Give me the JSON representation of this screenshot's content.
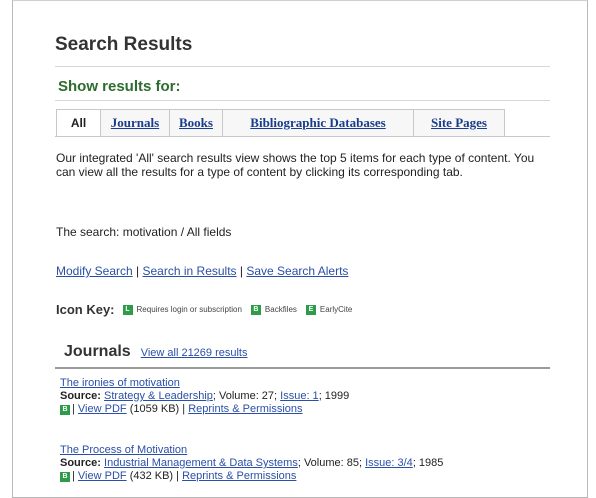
{
  "page": {
    "title": "Search Results",
    "show_results_for": "Show results for:"
  },
  "tabs": [
    {
      "label": "All",
      "active": true
    },
    {
      "label": "Journals",
      "active": false
    },
    {
      "label": "Books",
      "active": false
    },
    {
      "label": "Bibliographic Databases",
      "active": false
    },
    {
      "label": "Site Pages",
      "active": false
    }
  ],
  "description": "Our integrated 'All' search results view shows the top 5 items for each type of content. You can view all the results for a type of content by clicking its corresponding tab.",
  "search_summary": "The search: motivation / All fields",
  "actions": {
    "modify": "Modify Search",
    "search_in_results": "Search in Results",
    "save_alerts": "Save Search Alerts",
    "separator": " | "
  },
  "icon_key": {
    "label": "Icon Key:",
    "items": [
      {
        "icon": "login-required-icon",
        "glyph": "L",
        "text": "Requires login or subscription"
      },
      {
        "icon": "backfiles-icon",
        "glyph": "B",
        "text": "Backfiles"
      },
      {
        "icon": "earlycite-icon",
        "glyph": "E",
        "text": "EarlyCite"
      }
    ],
    "icon_color": "#2e9b4a"
  },
  "journals": {
    "heading": "Journals",
    "view_all": "View all 21269 results",
    "results": [
      {
        "title": "The ironies of motivation",
        "source_label": "Source:",
        "journal": "Strategy & Leadership",
        "volume_text": "; Volume: 27; ",
        "issue": "Issue: 1",
        "year": "; 1999",
        "pdf_icon_glyph": "B",
        "pdf_label": "View PDF",
        "pdf_size": "(1059 KB)",
        "permissions": "Reprints & Permissions"
      },
      {
        "title": "The Process of Motivation",
        "source_label": "Source:",
        "journal": "Industrial Management & Data Systems",
        "volume_text": "; Volume: 85; ",
        "issue": "Issue: 3/4",
        "year": "; 1985",
        "pdf_icon_glyph": "B",
        "pdf_label": "View PDF",
        "pdf_size": "(432 KB)",
        "permissions": "Reprints & Permissions"
      }
    ]
  },
  "colors": {
    "heading_green": "#2e6b2e",
    "link_blue": "#2a4fa8",
    "tab_link_blue": "#1a3c8c"
  }
}
